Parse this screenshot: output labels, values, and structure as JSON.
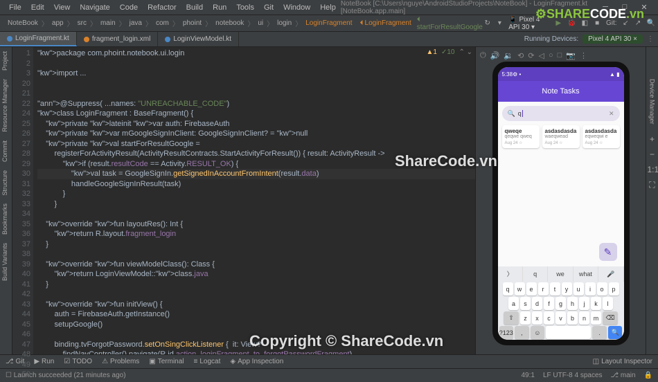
{
  "menu": [
    "File",
    "Edit",
    "View",
    "Navigate",
    "Code",
    "Refactor",
    "Build",
    "Run",
    "Tools",
    "Git",
    "Window",
    "Help"
  ],
  "window_title": "NoteBook [C:\\Users\\nguye\\AndroidStudioProjects\\NoteBook] - LoginFragment.kt [NoteBook.app.main]",
  "breadcrumb": [
    "NoteBook",
    "app",
    "src",
    "main",
    "java",
    "com",
    "phoint",
    "notebook",
    "ui",
    "login",
    "LoginFragment"
  ],
  "toolbar_items": {
    "device": "Pixel 4 API 30",
    "run_config": "LoginFragment",
    "git": "Git:"
  },
  "tabs": [
    {
      "name": "LoginFragment.kt",
      "active": true,
      "icon": "blue"
    },
    {
      "name": "fragment_login.xml",
      "active": false,
      "icon": "orange"
    },
    {
      "name": "LoginViewModel.kt",
      "active": false,
      "icon": "blue"
    }
  ],
  "running_devices_label": "Running Devices:",
  "running_device": "Pixel 4 API 30",
  "left_strip": [
    "Project",
    "Resource Manager",
    "Commit",
    "Structure",
    "Bookmarks",
    "Build Variants"
  ],
  "code": {
    "lines": [
      {
        "n": 1,
        "t": "package com.phoint.notebook.ui.login",
        "cls": "kw-pkg"
      },
      {
        "n": 2,
        "t": ""
      },
      {
        "n": 3,
        "t": "import ...",
        "cls": "kw"
      },
      {
        "n": 20,
        "t": ""
      },
      {
        "n": 21,
        "t": ""
      },
      {
        "n": 22,
        "t": "@Suppress( ...names: \"UNREACHABLE_CODE\")",
        "cls": "ann"
      },
      {
        "n": 24,
        "t": "class LoginFragment : BaseFragment<FragmentLoginBinding, LoginViewModel>() {"
      },
      {
        "n": 25,
        "t": "    private lateinit var auth: FirebaseAuth"
      },
      {
        "n": 26,
        "t": "    private var mGoogleSignInClient: GoogleSignInClient? = null"
      },
      {
        "n": 27,
        "t": "    private val startForResultGoogle ="
      },
      {
        "n": 28,
        "t": "        registerForActivityResult(ActivityResultContracts.StartActivityForResult()) { result: ActivityResult ->"
      },
      {
        "n": 29,
        "t": "            if (result.resultCode == Activity.RESULT_OK) {"
      },
      {
        "n": 30,
        "t": "                val task = GoogleSignIn.getSignedInAccountFromIntent(result.data)"
      },
      {
        "n": 31,
        "t": "                handleGoogleSignInResult(task)"
      },
      {
        "n": 32,
        "t": "            }"
      },
      {
        "n": 33,
        "t": "        }"
      },
      {
        "n": 34,
        "t": ""
      },
      {
        "n": 35,
        "t": "    override fun layoutRes(): Int {"
      },
      {
        "n": 36,
        "t": "        return R.layout.fragment_login"
      },
      {
        "n": 37,
        "t": "    }"
      },
      {
        "n": 38,
        "t": ""
      },
      {
        "n": 39,
        "t": "    override fun viewModelClass(): Class<LoginViewModel> {"
      },
      {
        "n": 40,
        "t": "        return LoginViewModel::class.java"
      },
      {
        "n": 41,
        "t": "    }"
      },
      {
        "n": 42,
        "t": ""
      },
      {
        "n": 43,
        "t": "    override fun initView() {"
      },
      {
        "n": 44,
        "t": "        auth = FirebaseAuth.getInstance()"
      },
      {
        "n": 45,
        "t": "        setupGoogle()"
      },
      {
        "n": 46,
        "t": ""
      },
      {
        "n": 47,
        "t": "        binding.tvForgotPassword.setOnSingClickListener {  it: View?"
      },
      {
        "n": 48,
        "t": "            findNavController().navigate(R.id.action_loginFragment_to_forgotPasswordFragment)"
      },
      {
        "n": 49,
        "t": "        }"
      },
      {
        "n": 50,
        "t": ""
      }
    ],
    "warnings": "▲1 ✓10 ⌃ ⌄"
  },
  "emulator": {
    "time": "5:38",
    "app_title": "Note Tasks",
    "search_value": "q",
    "cards": [
      {
        "title": "qweqe",
        "sub": "qeqwe qweq",
        "date": "Aug 24"
      },
      {
        "title": "asdasdasda",
        "sub": "waeqwead",
        "date": "Aug 24"
      },
      {
        "title": "asdasdasda",
        "sub": "eqweqwi e",
        "date": "Aug 24"
      }
    ],
    "suggestions": [
      "q",
      "we",
      "what"
    ],
    "keyboard_rows": [
      [
        "q",
        "w",
        "e",
        "r",
        "t",
        "y",
        "u",
        "i",
        "o",
        "p"
      ],
      [
        "a",
        "s",
        "d",
        "f",
        "g",
        "h",
        "j",
        "k",
        "l"
      ],
      [
        "⇧",
        "z",
        "x",
        "c",
        "v",
        "b",
        "n",
        "m",
        "⌫"
      ],
      [
        "?123",
        ",",
        "☺",
        " ",
        ".",
        "🔍"
      ]
    ]
  },
  "bottom": [
    "Git",
    "Run",
    "TODO",
    "Problems",
    "Terminal",
    "Logcat",
    "App Inspection"
  ],
  "status": {
    "msg": "Launch succeeded (21 minutes ago)",
    "pos": "49:1",
    "enc": "LF  UTF-8  4 spaces",
    "branch": "main"
  },
  "right_tools": [
    "Layout Inspector"
  ],
  "watermark": "ShareCode.vn",
  "watermark2": "Copyright © ShareCode.vn",
  "logo": "SHARECODE.vn"
}
